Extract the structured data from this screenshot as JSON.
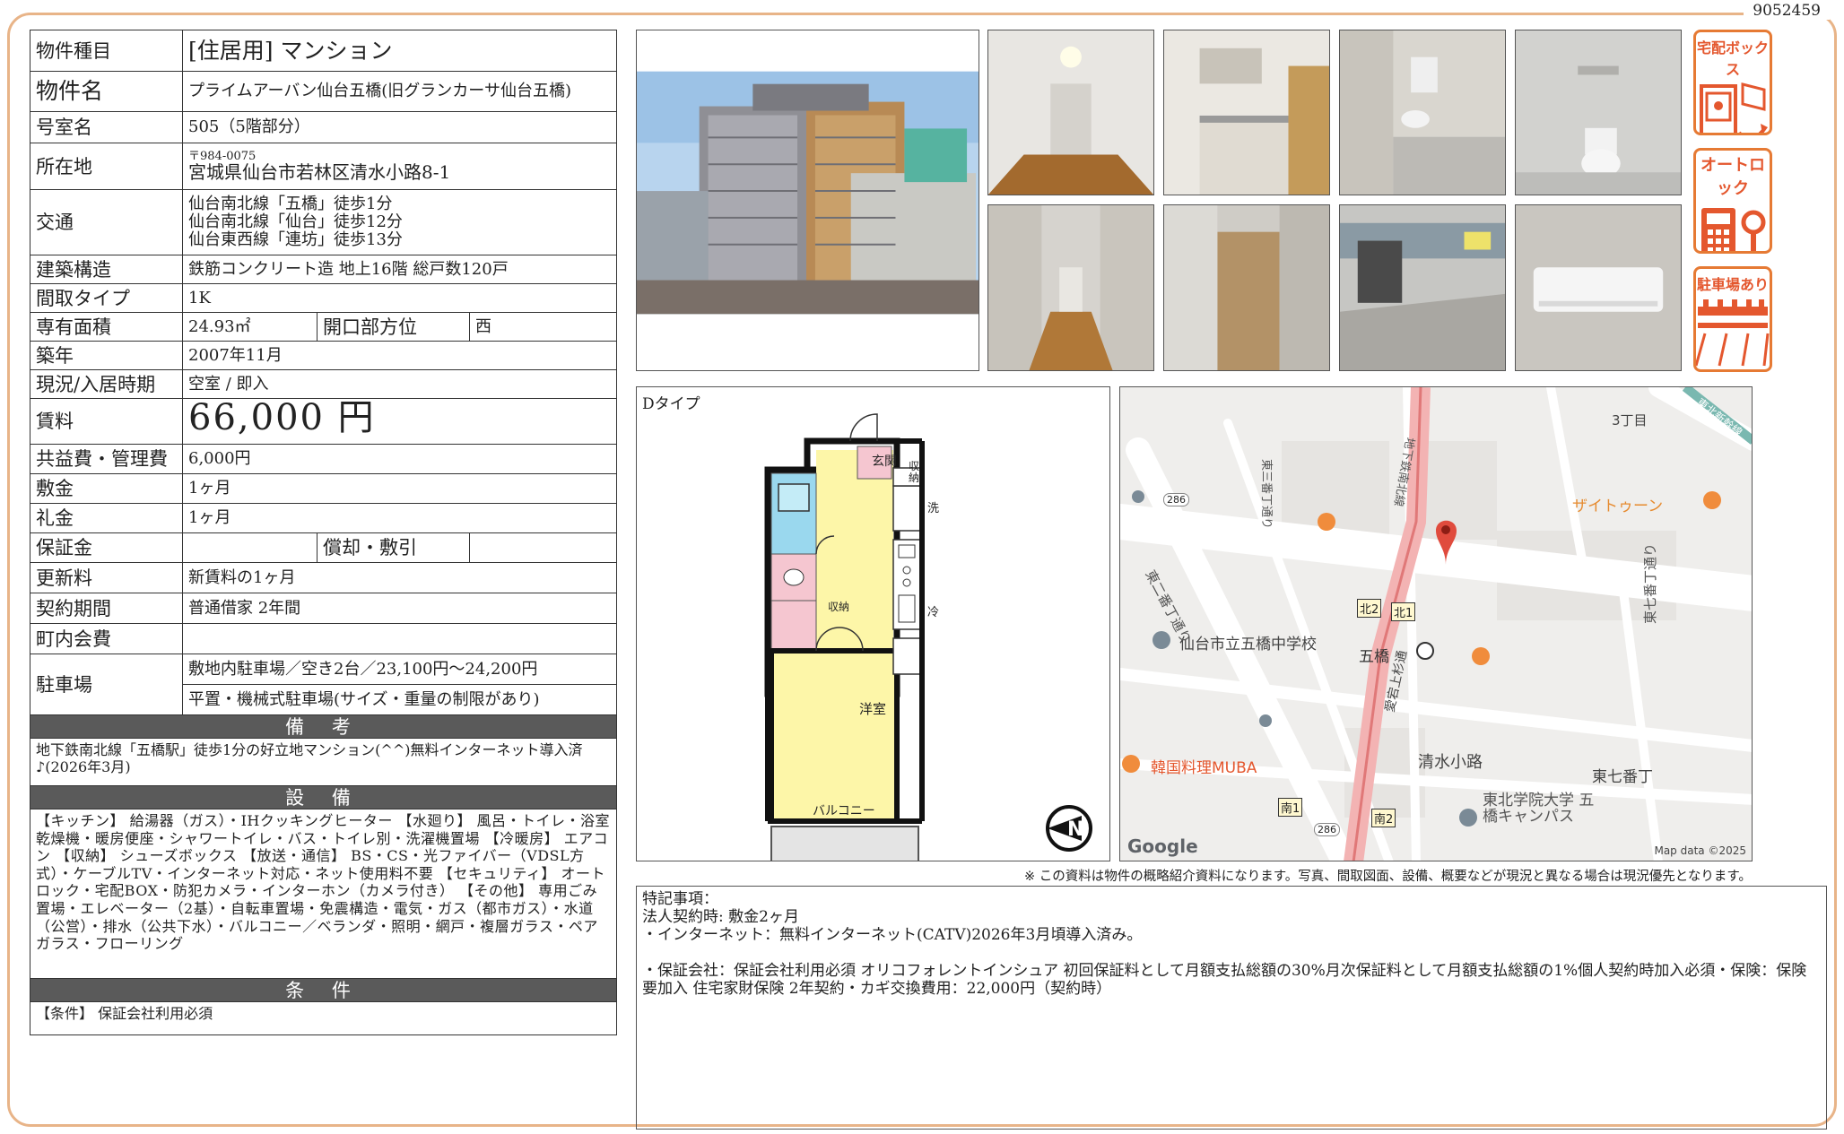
{
  "doc_id": "9052459",
  "spec": {
    "property_type_label": "物件種目",
    "property_type": "[住居用]  マンション",
    "name_label": "物件名",
    "name": "プライムアーバン仙台五橋(旧グランカーサ仙台五橋)",
    "room_label": "号室名",
    "room": "505（5階部分）",
    "address_label": "所在地",
    "postal": "〒984-0075",
    "address": "宮城県仙台市若林区清水小路8-1",
    "transport_label": "交通",
    "transport": [
      "仙台南北線「五橋」徒歩1分",
      "仙台南北線「仙台」徒歩12分",
      "仙台東西線「連坊」徒歩13分"
    ],
    "structure_label": "建築構造",
    "structure": "鉄筋コンクリート造 地上16階 総戸数120戸",
    "layout_label": "間取タイプ",
    "layout": "1K",
    "area_label": "専有面積",
    "area": "24.93㎡",
    "direction_label": "開口部方位",
    "direction": "西",
    "built_label": "築年",
    "built": "2007年11月",
    "status_label": "現況/入居時期",
    "status": "空室 /  即入",
    "rent_label": "賃料",
    "rent": "66,000 円",
    "fee_label": "共益費・管理費",
    "fee": "6,000円",
    "deposit_label": "敷金",
    "deposit": "1ヶ月",
    "key_money_label": "礼金",
    "key_money": "1ヶ月",
    "guarantee_label": "保証金",
    "guarantee": "",
    "amort_label": "償却・敷引",
    "amort": "",
    "renewal_label": "更新料",
    "renewal": "新賃料の1ヶ月",
    "contract_label": "契約期間",
    "contract": "普通借家  2年間",
    "community_label": "町内会費",
    "community": "",
    "parking_label": "駐車場",
    "parking": [
      "敷地内駐車場／空き2台／23,100円〜24,200円",
      "平置・機械式駐車場(サイズ・重量の制限があり)"
    ]
  },
  "remarks": {
    "title": "備 考",
    "text": "地下鉄南北線「五橋駅」徒歩1分の好立地マンション(^^)無料インターネット導入済♪(2026年3月)"
  },
  "equipment": {
    "title": "設 備",
    "text": "【キッチン】 給湯器（ガス）・IHクッキングヒーター 【水廻り】 風呂・トイレ・浴室乾燥機・暖房便座・シャワートイレ・バス・トイレ別・洗濯機置場 【冷暖房】 エアコン 【収納】 シューズボックス 【放送・通信】 BS・CS・光ファイバー（VDSL方式）・ケーブルTV・インターネット対応・ネット使用料不要 【セキュリティ】 オートロック・宅配BOX・防犯カメラ・インターホン（カメラ付き） 【その他】 専用ごみ置場・エレベーター（2基）・自転車置場・免震構造・電気・ガス（都市ガス）・水道（公営）・排水（公共下水）・バルコニー／ベランダ・照明・網戸・複層ガラス・ペアガラス・フローリング"
  },
  "conditions": {
    "title": "条 件",
    "text": "【条件】 保証会社利用必須"
  },
  "badges": {
    "delivery_box": "宅配ボックス",
    "auto_lock": "オートロック",
    "parking": "駐車場あり"
  },
  "floorplan": {
    "type": "Dタイプ",
    "rooms": {
      "entrance": "玄関",
      "storage": "収納",
      "storage_v": [
        "収",
        "納"
      ],
      "washer": "洗",
      "fridge": "冷",
      "closet": "収納",
      "western": "洋室",
      "balcony": "バルコニー"
    }
  },
  "map": {
    "labels": {
      "chome3": "3丁目",
      "saitone": "ザイトゥーン",
      "school": "仙台市立五橋中学校",
      "itsutsubashi": "五橋",
      "shimizu": "清水小路",
      "muba": "韓国料理MUBA",
      "higashi7": "東七番丁",
      "gakuin": "東北学院大学 五",
      "gakuin2": "橋キャンパス",
      "google": "Google",
      "mapdata": "Map data ©2025",
      "kita1": "北1",
      "kita2": "北2",
      "minami1": "南1",
      "minami2": "南2",
      "r286a": "286",
      "r286b": "286",
      "higashi2": "東二番丁通り",
      "higashi3": "東三番丁通り",
      "higashi7st": "東七番丁通り",
      "subway": "地下鉄南北線",
      "aoba": "愛宕上杉通",
      "shinkansen": "東北新幹線"
    }
  },
  "disclaimer": "※ この資料は物件の概略紹介資料になります。写真、間取図面、設備、概要などが現況と異なる場合は現況優先となります。",
  "special": {
    "lines": [
      "特記事項：",
      "法人契約時: 敷金2ヶ月",
      "・インターネット：無料インターネット(CATV)2026年3月頃導入済み。",
      "",
      "・保証会社：保証会社利用必須 オリコフォレントインシュア 初回保証料として月額支払総額の30%月次保証料として月額支払総額の1%個人契約時加入必須・保険：保険要加入 住宅家財保険 2年契約・カギ交換費用：22,000円（契約時）"
    ]
  },
  "colors": {
    "frame": "#e8b488",
    "band": "#5a5a5a",
    "badge": "#e4572e",
    "plan_yellow": "#fdf6a8",
    "plan_pink": "#f5c6d0",
    "plan_blue": "#9ad8ee"
  }
}
